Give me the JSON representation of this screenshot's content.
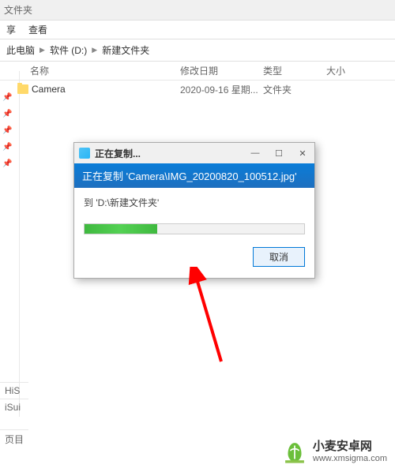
{
  "topstrip": {
    "label": "文件夹"
  },
  "toolbar": {
    "share": "享",
    "view": "查看"
  },
  "breadcrumb": {
    "b1": "此电脑",
    "b2": "软件 (D:)",
    "b3": "新建文件夹"
  },
  "columns": {
    "name": "名称",
    "date": "修改日期",
    "type": "类型",
    "size": "大小"
  },
  "row": {
    "name": "Camera",
    "date": "2020-09-16 星期...",
    "type": "文件夹"
  },
  "dialog": {
    "title": "正在复制...",
    "banner": "正在复制 'Camera\\IMG_20200820_100512.jpg'",
    "dest": "到 'D:\\新建文件夹'",
    "cancel": "取消",
    "min": "—",
    "max": "☐",
    "close": "✕"
  },
  "bottom": {
    "i1": "HiS",
    "i2": "iSui",
    "i3": "页目"
  },
  "watermark": {
    "t1": "小麦安卓网",
    "t2": "www.xmsigma.com"
  }
}
